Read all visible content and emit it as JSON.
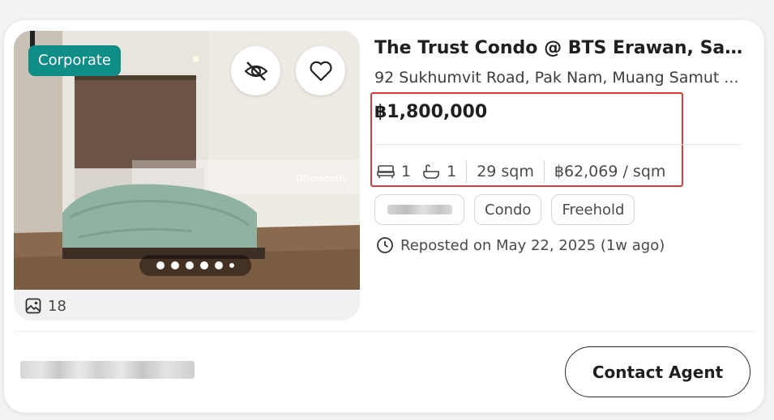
{
  "listing": {
    "badge": "Corporate",
    "photo_count": "18",
    "watermark_text": "DDproperty",
    "carousel": {
      "total_dots": 6,
      "active_dot": 1
    },
    "title": "The Trust Condo @ BTS Erawan, Sam...",
    "address": "92 Sukhumvit Road, Pak Nam, Muang Samut ...",
    "price": "฿1,800,000",
    "specs": {
      "bedrooms": "1",
      "bathrooms": "1",
      "area": "29 sqm",
      "price_per_area": "฿62,069 / sqm"
    },
    "tags": [
      "Condo",
      "Freehold"
    ],
    "reposted": "Reposted on May 22, 2025 (1w ago)"
  },
  "actions": {
    "contact_label": "Contact Agent"
  },
  "icons": {
    "hide": "eye-slash-icon",
    "favorite": "heart-icon",
    "gallery": "image-icon",
    "bed": "bed-icon",
    "bath": "bathtub-icon",
    "clock": "clock-icon"
  },
  "colors": {
    "badge_bg": "#0e8e86",
    "highlight": "#e53935",
    "text": "#1f1f1f"
  }
}
